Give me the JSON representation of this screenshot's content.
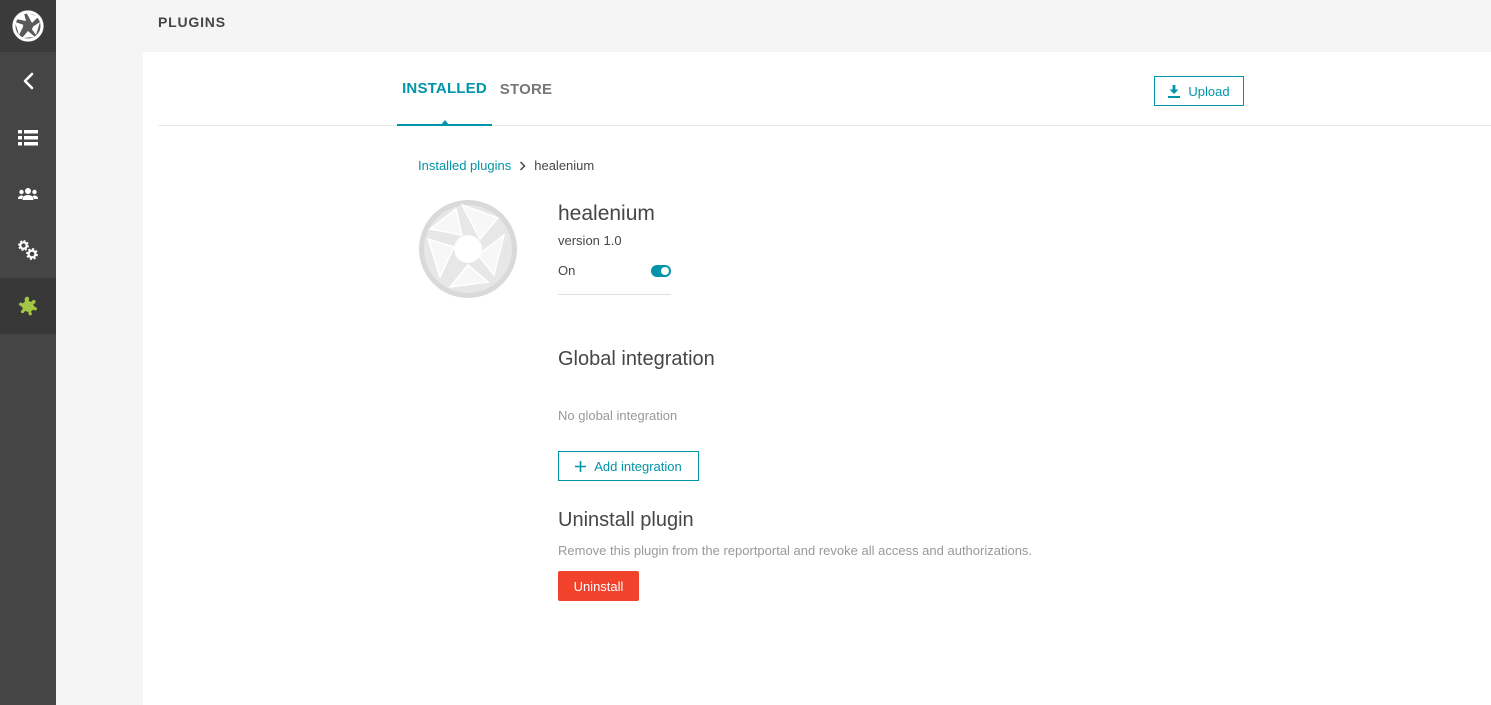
{
  "sidebar": {
    "logo_icon": "aperture-icon",
    "items": [
      {
        "icon": "chevron-left-icon",
        "active": false
      },
      {
        "icon": "list-icon",
        "active": false
      },
      {
        "icon": "users-icon",
        "active": false
      },
      {
        "icon": "gears-icon",
        "active": false
      },
      {
        "icon": "puzzle-icon",
        "active": true
      }
    ],
    "colors": {
      "background": "#454545",
      "active_background": "#383838",
      "icon": "#ffffff",
      "active_icon": "#a3c644"
    }
  },
  "header": {
    "title": "PLUGINS"
  },
  "tabs": [
    {
      "label": "INSTALLED",
      "active": true
    },
    {
      "label": "STORE",
      "active": false
    }
  ],
  "toolbar": {
    "upload_label": "Upload",
    "upload_icon": "download-icon"
  },
  "breadcrumb": {
    "parent": "Installed plugins",
    "current": "healenium"
  },
  "plugin": {
    "name": "healenium",
    "version": "version 1.0",
    "status_label": "On",
    "enabled": true,
    "logo_icon": "aperture-icon"
  },
  "global_integration": {
    "title": "Global integration",
    "empty_text": "No global integration",
    "add_label": "Add integration",
    "add_icon": "plus-icon"
  },
  "uninstall": {
    "title": "Uninstall plugin",
    "description": "Remove this plugin from the reportportal and revoke all access and authorizations.",
    "button_label": "Uninstall"
  },
  "colors": {
    "accent": "#0094a8",
    "danger": "#f1432c",
    "text": "#464547",
    "muted": "#999999"
  }
}
